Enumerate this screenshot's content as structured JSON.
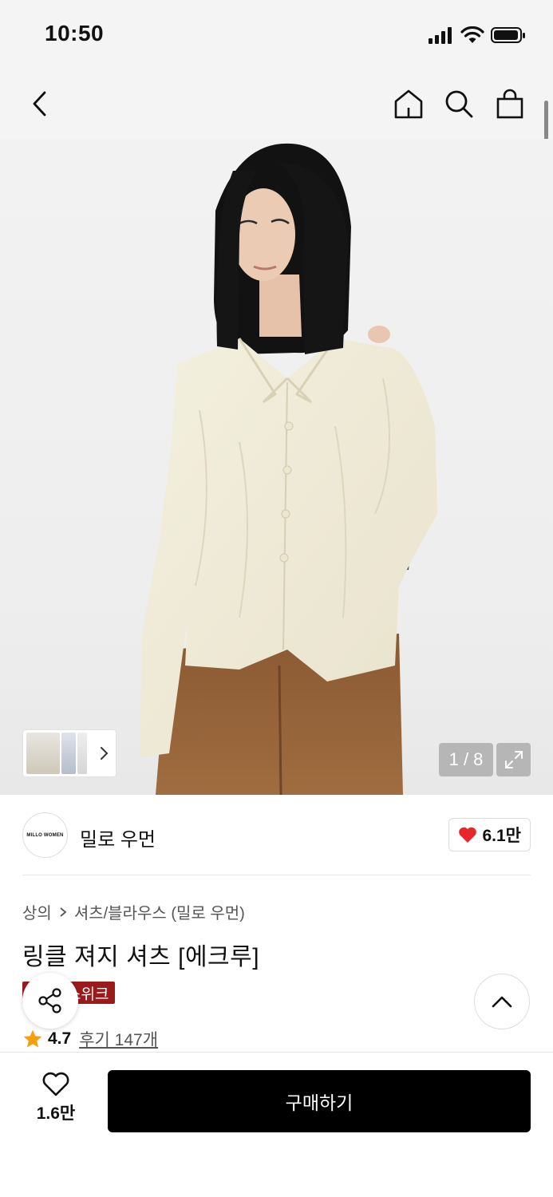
{
  "status_bar": {
    "time": "10:50",
    "icons": [
      "signal-icon",
      "wifi-icon",
      "battery-icon"
    ]
  },
  "nav": {
    "back": "back-icon",
    "actions": [
      "home-icon",
      "search-icon",
      "shopping-bag-icon"
    ]
  },
  "gallery": {
    "counter": "1 / 8",
    "expand": "expand-icon"
  },
  "brand": {
    "logo_text": "MILLO WOMEN",
    "name": "밀로 우먼",
    "likes": "6.1만",
    "heart_color": "#e8272b"
  },
  "product": {
    "breadcrumb": [
      "상의",
      "셔츠/블라우스 (밀로 우먼)"
    ],
    "title": "링클 져지 셔츠 [에크루]",
    "badge": "스위크",
    "badge_color": "#9b1b1b",
    "rating": "4.7",
    "review_link": "후기 147개",
    "star_color": "#f5a00b"
  },
  "bottom_bar": {
    "wish_count": "1.6만",
    "buy_label": "구매하기"
  }
}
